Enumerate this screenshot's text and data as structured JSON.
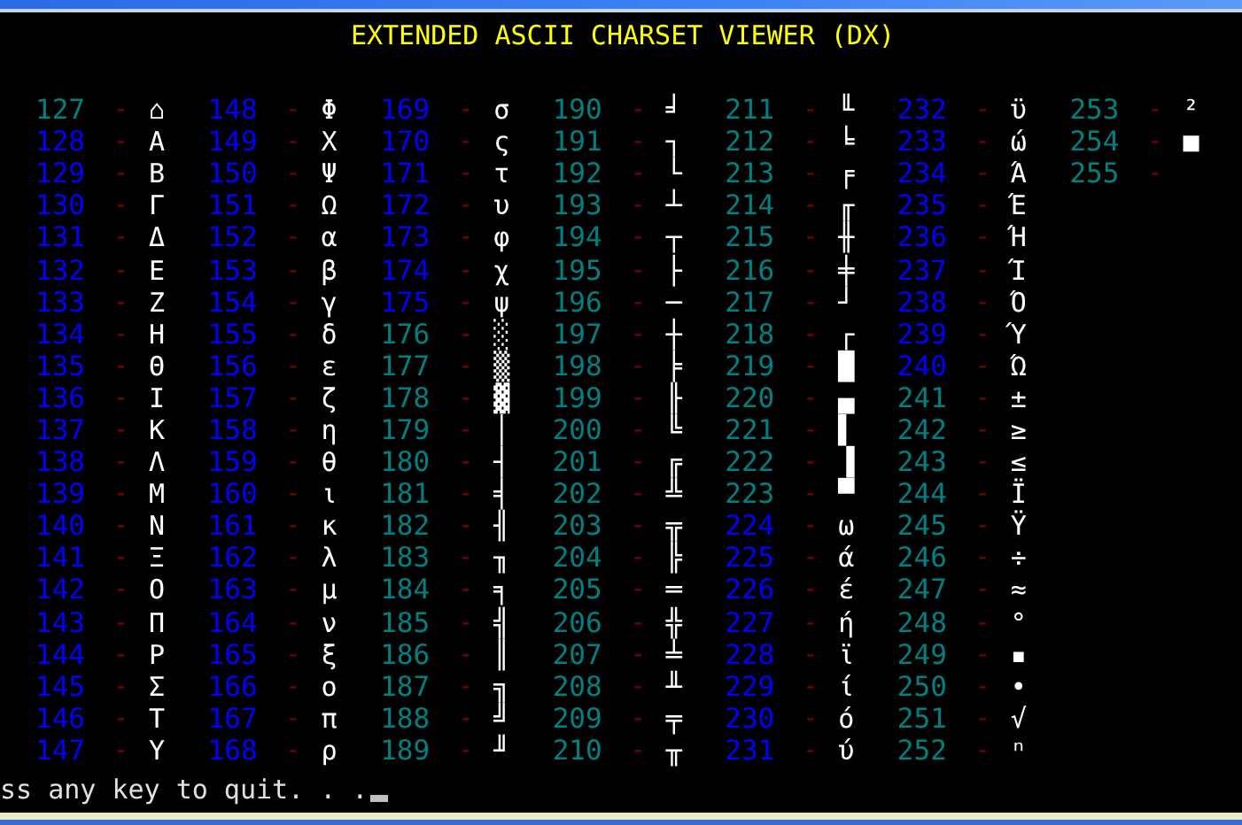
{
  "title": "EXTENDED ASCII CHARSET VIEWER (DX)",
  "columns": [
    [
      {
        "code": "127",
        "sep": "-",
        "char": "⌂",
        "color": "#008080"
      },
      {
        "code": "128",
        "sep": "-",
        "char": "Α",
        "color": "#0000ff"
      },
      {
        "code": "129",
        "sep": "-",
        "char": "Β",
        "color": "#0000ff"
      },
      {
        "code": "130",
        "sep": "-",
        "char": "Γ",
        "color": "#0000ff"
      },
      {
        "code": "131",
        "sep": "-",
        "char": "Δ",
        "color": "#0000ff"
      },
      {
        "code": "132",
        "sep": "-",
        "char": "Ε",
        "color": "#0000ff"
      },
      {
        "code": "133",
        "sep": "-",
        "char": "Ζ",
        "color": "#0000ff"
      },
      {
        "code": "134",
        "sep": "-",
        "char": "Η",
        "color": "#0000ff"
      },
      {
        "code": "135",
        "sep": "-",
        "char": "Θ",
        "color": "#0000ff"
      },
      {
        "code": "136",
        "sep": "-",
        "char": "Ι",
        "color": "#0000ff"
      },
      {
        "code": "137",
        "sep": "-",
        "char": "Κ",
        "color": "#0000ff"
      },
      {
        "code": "138",
        "sep": "-",
        "char": "Λ",
        "color": "#0000ff"
      },
      {
        "code": "139",
        "sep": "-",
        "char": "Μ",
        "color": "#0000ff"
      },
      {
        "code": "140",
        "sep": "-",
        "char": "Ν",
        "color": "#0000ff"
      },
      {
        "code": "141",
        "sep": "-",
        "char": "Ξ",
        "color": "#0000ff"
      },
      {
        "code": "142",
        "sep": "-",
        "char": "Ο",
        "color": "#0000ff"
      },
      {
        "code": "143",
        "sep": "-",
        "char": "Π",
        "color": "#0000ff"
      },
      {
        "code": "144",
        "sep": "-",
        "char": "Ρ",
        "color": "#0000ff"
      },
      {
        "code": "145",
        "sep": "-",
        "char": "Σ",
        "color": "#0000ff"
      },
      {
        "code": "146",
        "sep": "-",
        "char": "Τ",
        "color": "#0000ff"
      },
      {
        "code": "147",
        "sep": "-",
        "char": "Υ",
        "color": "#0000ff"
      }
    ],
    [
      {
        "code": "148",
        "sep": "-",
        "char": "Φ",
        "color": "#0000ff"
      },
      {
        "code": "149",
        "sep": "-",
        "char": "Χ",
        "color": "#0000ff"
      },
      {
        "code": "150",
        "sep": "-",
        "char": "Ψ",
        "color": "#0000ff"
      },
      {
        "code": "151",
        "sep": "-",
        "char": "Ω",
        "color": "#0000ff"
      },
      {
        "code": "152",
        "sep": "-",
        "char": "α",
        "color": "#0000ff"
      },
      {
        "code": "153",
        "sep": "-",
        "char": "β",
        "color": "#0000ff"
      },
      {
        "code": "154",
        "sep": "-",
        "char": "γ",
        "color": "#0000ff"
      },
      {
        "code": "155",
        "sep": "-",
        "char": "δ",
        "color": "#0000ff"
      },
      {
        "code": "156",
        "sep": "-",
        "char": "ε",
        "color": "#0000ff"
      },
      {
        "code": "157",
        "sep": "-",
        "char": "ζ",
        "color": "#0000ff"
      },
      {
        "code": "158",
        "sep": "-",
        "char": "η",
        "color": "#0000ff"
      },
      {
        "code": "159",
        "sep": "-",
        "char": "θ",
        "color": "#0000ff"
      },
      {
        "code": "160",
        "sep": "-",
        "char": "ι",
        "color": "#0000ff"
      },
      {
        "code": "161",
        "sep": "-",
        "char": "κ",
        "color": "#0000ff"
      },
      {
        "code": "162",
        "sep": "-",
        "char": "λ",
        "color": "#0000ff"
      },
      {
        "code": "163",
        "sep": "-",
        "char": "μ",
        "color": "#0000ff"
      },
      {
        "code": "164",
        "sep": "-",
        "char": "ν",
        "color": "#0000ff"
      },
      {
        "code": "165",
        "sep": "-",
        "char": "ξ",
        "color": "#0000ff"
      },
      {
        "code": "166",
        "sep": "-",
        "char": "ο",
        "color": "#0000ff"
      },
      {
        "code": "167",
        "sep": "-",
        "char": "π",
        "color": "#0000ff"
      },
      {
        "code": "168",
        "sep": "-",
        "char": "ρ",
        "color": "#0000ff"
      }
    ],
    [
      {
        "code": "169",
        "sep": "-",
        "char": "σ",
        "color": "#0000ff"
      },
      {
        "code": "170",
        "sep": "-",
        "char": "ς",
        "color": "#0000ff"
      },
      {
        "code": "171",
        "sep": "-",
        "char": "τ",
        "color": "#0000ff"
      },
      {
        "code": "172",
        "sep": "-",
        "char": "υ",
        "color": "#0000ff"
      },
      {
        "code": "173",
        "sep": "-",
        "char": "φ",
        "color": "#0000ff"
      },
      {
        "code": "174",
        "sep": "-",
        "char": "χ",
        "color": "#0000ff"
      },
      {
        "code": "175",
        "sep": "-",
        "char": "ψ",
        "color": "#0000ff"
      },
      {
        "code": "176",
        "sep": "-",
        "char": "░",
        "color": "#008080"
      },
      {
        "code": "177",
        "sep": "-",
        "char": "▒",
        "color": "#008080"
      },
      {
        "code": "178",
        "sep": "-",
        "char": "▓",
        "color": "#008080"
      },
      {
        "code": "179",
        "sep": "-",
        "char": "│",
        "color": "#008080"
      },
      {
        "code": "180",
        "sep": "-",
        "char": "┤",
        "color": "#008080"
      },
      {
        "code": "181",
        "sep": "-",
        "char": "╡",
        "color": "#008080"
      },
      {
        "code": "182",
        "sep": "-",
        "char": "╢",
        "color": "#008080"
      },
      {
        "code": "183",
        "sep": "-",
        "char": "╖",
        "color": "#008080"
      },
      {
        "code": "184",
        "sep": "-",
        "char": "╕",
        "color": "#008080"
      },
      {
        "code": "185",
        "sep": "-",
        "char": "╣",
        "color": "#008080"
      },
      {
        "code": "186",
        "sep": "-",
        "char": "║",
        "color": "#008080"
      },
      {
        "code": "187",
        "sep": "-",
        "char": "╗",
        "color": "#008080"
      },
      {
        "code": "188",
        "sep": "-",
        "char": "╝",
        "color": "#008080"
      },
      {
        "code": "189",
        "sep": "-",
        "char": "╜",
        "color": "#008080"
      }
    ],
    [
      {
        "code": "190",
        "sep": "-",
        "char": "╛",
        "color": "#008080"
      },
      {
        "code": "191",
        "sep": "-",
        "char": "┐",
        "color": "#008080"
      },
      {
        "code": "192",
        "sep": "-",
        "char": "└",
        "color": "#008080"
      },
      {
        "code": "193",
        "sep": "-",
        "char": "┴",
        "color": "#008080"
      },
      {
        "code": "194",
        "sep": "-",
        "char": "┬",
        "color": "#008080"
      },
      {
        "code": "195",
        "sep": "-",
        "char": "├",
        "color": "#008080"
      },
      {
        "code": "196",
        "sep": "-",
        "char": "─",
        "color": "#008080"
      },
      {
        "code": "197",
        "sep": "-",
        "char": "┼",
        "color": "#008080"
      },
      {
        "code": "198",
        "sep": "-",
        "char": "╞",
        "color": "#008080"
      },
      {
        "code": "199",
        "sep": "-",
        "char": "╟",
        "color": "#008080"
      },
      {
        "code": "200",
        "sep": "-",
        "char": "╚",
        "color": "#008080"
      },
      {
        "code": "201",
        "sep": "-",
        "char": "╔",
        "color": "#008080"
      },
      {
        "code": "202",
        "sep": "-",
        "char": "╩",
        "color": "#008080"
      },
      {
        "code": "203",
        "sep": "-",
        "char": "╦",
        "color": "#008080"
      },
      {
        "code": "204",
        "sep": "-",
        "char": "╠",
        "color": "#008080"
      },
      {
        "code": "205",
        "sep": "-",
        "char": "═",
        "color": "#008080"
      },
      {
        "code": "206",
        "sep": "-",
        "char": "╬",
        "color": "#008080"
      },
      {
        "code": "207",
        "sep": "-",
        "char": "╧",
        "color": "#008080"
      },
      {
        "code": "208",
        "sep": "-",
        "char": "╨",
        "color": "#008080"
      },
      {
        "code": "209",
        "sep": "-",
        "char": "╤",
        "color": "#008080"
      },
      {
        "code": "210",
        "sep": "-",
        "char": "╥",
        "color": "#008080"
      }
    ],
    [
      {
        "code": "211",
        "sep": "-",
        "char": "╙",
        "color": "#008080"
      },
      {
        "code": "212",
        "sep": "-",
        "char": "╘",
        "color": "#008080"
      },
      {
        "code": "213",
        "sep": "-",
        "char": "╒",
        "color": "#008080"
      },
      {
        "code": "214",
        "sep": "-",
        "char": "╓",
        "color": "#008080"
      },
      {
        "code": "215",
        "sep": "-",
        "char": "╫",
        "color": "#008080"
      },
      {
        "code": "216",
        "sep": "-",
        "char": "╪",
        "color": "#008080"
      },
      {
        "code": "217",
        "sep": "-",
        "char": "┘",
        "color": "#008080"
      },
      {
        "code": "218",
        "sep": "-",
        "char": "┌",
        "color": "#008080"
      },
      {
        "code": "219",
        "sep": "-",
        "char": "█",
        "color": "#008080"
      },
      {
        "code": "220",
        "sep": "-",
        "char": "▄",
        "color": "#008080"
      },
      {
        "code": "221",
        "sep": "-",
        "char": "▌",
        "color": "#008080"
      },
      {
        "code": "222",
        "sep": "-",
        "char": "▐",
        "color": "#008080"
      },
      {
        "code": "223",
        "sep": "-",
        "char": "▀",
        "color": "#008080"
      },
      {
        "code": "224",
        "sep": "-",
        "char": "ω",
        "color": "#0000ff"
      },
      {
        "code": "225",
        "sep": "-",
        "char": "ά",
        "color": "#0000ff"
      },
      {
        "code": "226",
        "sep": "-",
        "char": "έ",
        "color": "#0000ff"
      },
      {
        "code": "227",
        "sep": "-",
        "char": "ή",
        "color": "#0000ff"
      },
      {
        "code": "228",
        "sep": "-",
        "char": "ϊ",
        "color": "#0000ff"
      },
      {
        "code": "229",
        "sep": "-",
        "char": "ί",
        "color": "#0000ff"
      },
      {
        "code": "230",
        "sep": "-",
        "char": "ό",
        "color": "#0000ff"
      },
      {
        "code": "231",
        "sep": "-",
        "char": "ύ",
        "color": "#0000ff"
      }
    ],
    [
      {
        "code": "232",
        "sep": "-",
        "char": "ϋ",
        "color": "#0000ff"
      },
      {
        "code": "233",
        "sep": "-",
        "char": "ώ",
        "color": "#0000ff"
      },
      {
        "code": "234",
        "sep": "-",
        "char": "Ά",
        "color": "#0000ff"
      },
      {
        "code": "235",
        "sep": "-",
        "char": "Έ",
        "color": "#0000ff"
      },
      {
        "code": "236",
        "sep": "-",
        "char": "Ή",
        "color": "#0000ff"
      },
      {
        "code": "237",
        "sep": "-",
        "char": "Ί",
        "color": "#0000ff"
      },
      {
        "code": "238",
        "sep": "-",
        "char": "Ό",
        "color": "#0000ff"
      },
      {
        "code": "239",
        "sep": "-",
        "char": "Ύ",
        "color": "#0000ff"
      },
      {
        "code": "240",
        "sep": "-",
        "char": "Ώ",
        "color": "#0000ff"
      },
      {
        "code": "241",
        "sep": "-",
        "char": "±",
        "color": "#008080"
      },
      {
        "code": "242",
        "sep": "-",
        "char": "≥",
        "color": "#008080"
      },
      {
        "code": "243",
        "sep": "-",
        "char": "≤",
        "color": "#008080"
      },
      {
        "code": "244",
        "sep": "-",
        "char": "Ϊ",
        "color": "#008080"
      },
      {
        "code": "245",
        "sep": "-",
        "char": "Ϋ",
        "color": "#008080"
      },
      {
        "code": "246",
        "sep": "-",
        "char": "÷",
        "color": "#008080"
      },
      {
        "code": "247",
        "sep": "-",
        "char": "≈",
        "color": "#008080"
      },
      {
        "code": "248",
        "sep": "-",
        "char": "°",
        "color": "#008080"
      },
      {
        "code": "249",
        "sep": "-",
        "char": "▪",
        "color": "#008080"
      },
      {
        "code": "250",
        "sep": "-",
        "char": "•",
        "color": "#008080"
      },
      {
        "code": "251",
        "sep": "-",
        "char": "√",
        "color": "#008080"
      },
      {
        "code": "252",
        "sep": "-",
        "char": "ⁿ",
        "color": "#008080"
      }
    ],
    [
      {
        "code": "253",
        "sep": "-",
        "char": "²",
        "color": "#008080"
      },
      {
        "code": "254",
        "sep": "-",
        "char": "■",
        "color": "#008080"
      },
      {
        "code": "255",
        "sep": "-",
        "color": "#008080"
      }
    ]
  ],
  "prompt": "ss any key to quit. . ."
}
